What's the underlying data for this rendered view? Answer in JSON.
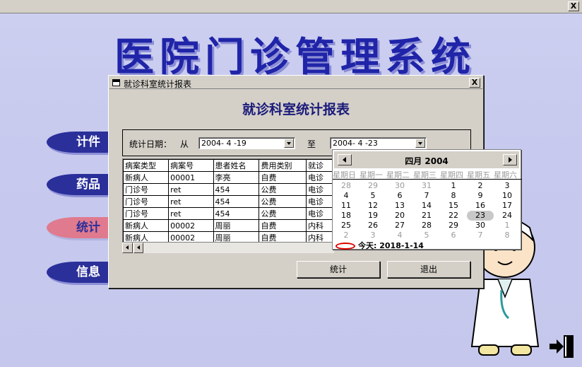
{
  "window": {
    "close_label": "X"
  },
  "app": {
    "title": "医院门诊管理系统"
  },
  "side_buttons": [
    {
      "label": "计件",
      "active": false
    },
    {
      "label": "药品",
      "active": false
    },
    {
      "label": "统计",
      "active": true
    },
    {
      "label": "信息",
      "active": false
    }
  ],
  "dialog": {
    "title": "就诊科室统计报表",
    "heading": "就诊科室统计报表",
    "close_label": "X",
    "filter": {
      "date_label": "统计日期：",
      "from_label": "从",
      "from_value": "2004- 4 -19",
      "to_label": "至",
      "to_value": "2004- 4 -23"
    },
    "grid": {
      "columns": [
        "病案类型",
        "病案号",
        "患者姓名",
        "费用类别",
        "就诊"
      ],
      "rows": [
        [
          "新病人",
          "00001",
          "李亮",
          "自费",
          "电诊"
        ],
        [
          "门诊号",
          "ret",
          "454",
          "公费",
          "电诊"
        ],
        [
          "门诊号",
          "ret",
          "454",
          "公费",
          "电诊"
        ],
        [
          "门诊号",
          "ret",
          "454",
          "公费",
          "电诊"
        ],
        [
          "新病人",
          "00002",
          "周丽",
          "自费",
          "内科"
        ],
        [
          "新病人",
          "00002",
          "周丽",
          "自费",
          "内科"
        ]
      ]
    },
    "buttons": {
      "stats": "统计",
      "exit": "退出"
    }
  },
  "calendar": {
    "month_label": "四月 2004",
    "weekdays": [
      "星期日",
      "星期一",
      "星期二",
      "星期三",
      "星期四",
      "星期五",
      "星期六"
    ],
    "weeks": [
      [
        [
          "28",
          1
        ],
        [
          "29",
          1
        ],
        [
          "30",
          1
        ],
        [
          "31",
          1
        ],
        [
          "1",
          0
        ],
        [
          "2",
          0
        ],
        [
          "3",
          0
        ]
      ],
      [
        [
          "4",
          0
        ],
        [
          "5",
          0
        ],
        [
          "6",
          0
        ],
        [
          "7",
          0
        ],
        [
          "8",
          0
        ],
        [
          "9",
          0
        ],
        [
          "10",
          0
        ]
      ],
      [
        [
          "11",
          0
        ],
        [
          "12",
          0
        ],
        [
          "13",
          0
        ],
        [
          "14",
          0
        ],
        [
          "15",
          0
        ],
        [
          "16",
          0
        ],
        [
          "17",
          0
        ]
      ],
      [
        [
          "18",
          0
        ],
        [
          "19",
          0
        ],
        [
          "20",
          0
        ],
        [
          "21",
          0
        ],
        [
          "22",
          0
        ],
        [
          "23",
          2
        ],
        [
          "24",
          0
        ]
      ],
      [
        [
          "25",
          0
        ],
        [
          "26",
          0
        ],
        [
          "27",
          0
        ],
        [
          "28",
          0
        ],
        [
          "29",
          0
        ],
        [
          "30",
          0
        ],
        [
          "1",
          1
        ]
      ],
      [
        [
          "2",
          1
        ],
        [
          "3",
          1
        ],
        [
          "4",
          1
        ],
        [
          "5",
          1
        ],
        [
          "6",
          1
        ],
        [
          "7",
          1
        ],
        [
          "8",
          1
        ]
      ]
    ],
    "today_label": "今天:",
    "today_value": "2018-1-14"
  }
}
